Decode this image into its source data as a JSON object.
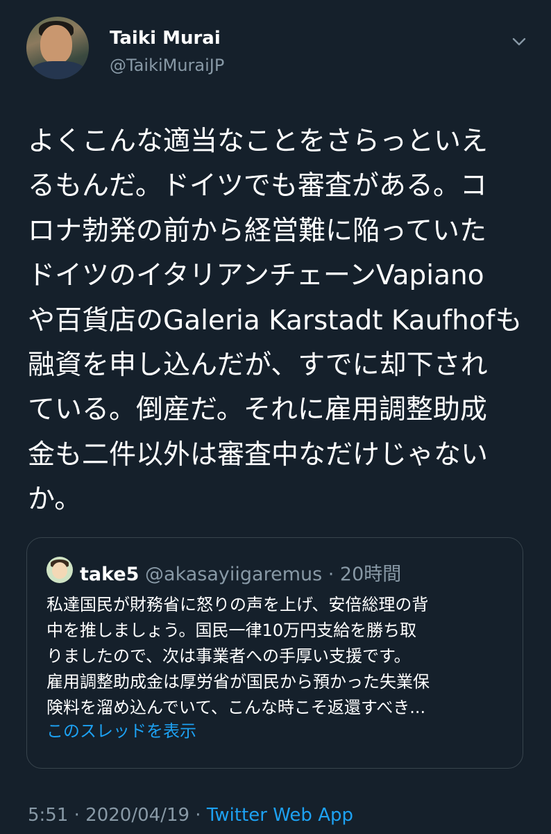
{
  "author": {
    "name": "Taiki Murai",
    "handle": "@TaikiMuraiJP"
  },
  "tweet": {
    "lines": [
      "よくこんな適当なことをさらっといえ",
      "るもんだ。ドイツでも審査がある。コ",
      "ロナ勃発の前から経営難に陥っていた",
      "ドイツのイタリアンチェーンVapiano",
      "や百貨店のGaleria Karstadt Kaufhofも",
      "融資を申し込んだが、すでに却下され",
      "ている。倒産だ。それに雇用調整助成",
      "金も二件以外は審査中なだけじゃない",
      "か。"
    ]
  },
  "quoted_tweet": {
    "name": "take5",
    "meta": " @akasayiigaremus · 20時間",
    "lines": [
      "私達国民が財務省に怒りの声を上げ、安倍総理の背",
      "中を推しましょう。国民一律10万円支給を勝ち取",
      "りましたので、次は事業者への手厚い支援です。",
      "雇用調整助成金は厚労省が国民から預かった失業保",
      "険料を溜め込んでいて、こんな時こそ返還すべき..."
    ],
    "show_thread": "このスレッドを表示"
  },
  "footer": {
    "timestamp": "5:51 · 2020/04/19 · ",
    "app": "Twitter Web App"
  },
  "icons": {
    "menu": "chevron-down-icon"
  },
  "colors": {
    "background": "#15202b",
    "text": "#ffffff",
    "muted": "#8899a6",
    "link": "#1da1f2",
    "border": "#38444d"
  }
}
